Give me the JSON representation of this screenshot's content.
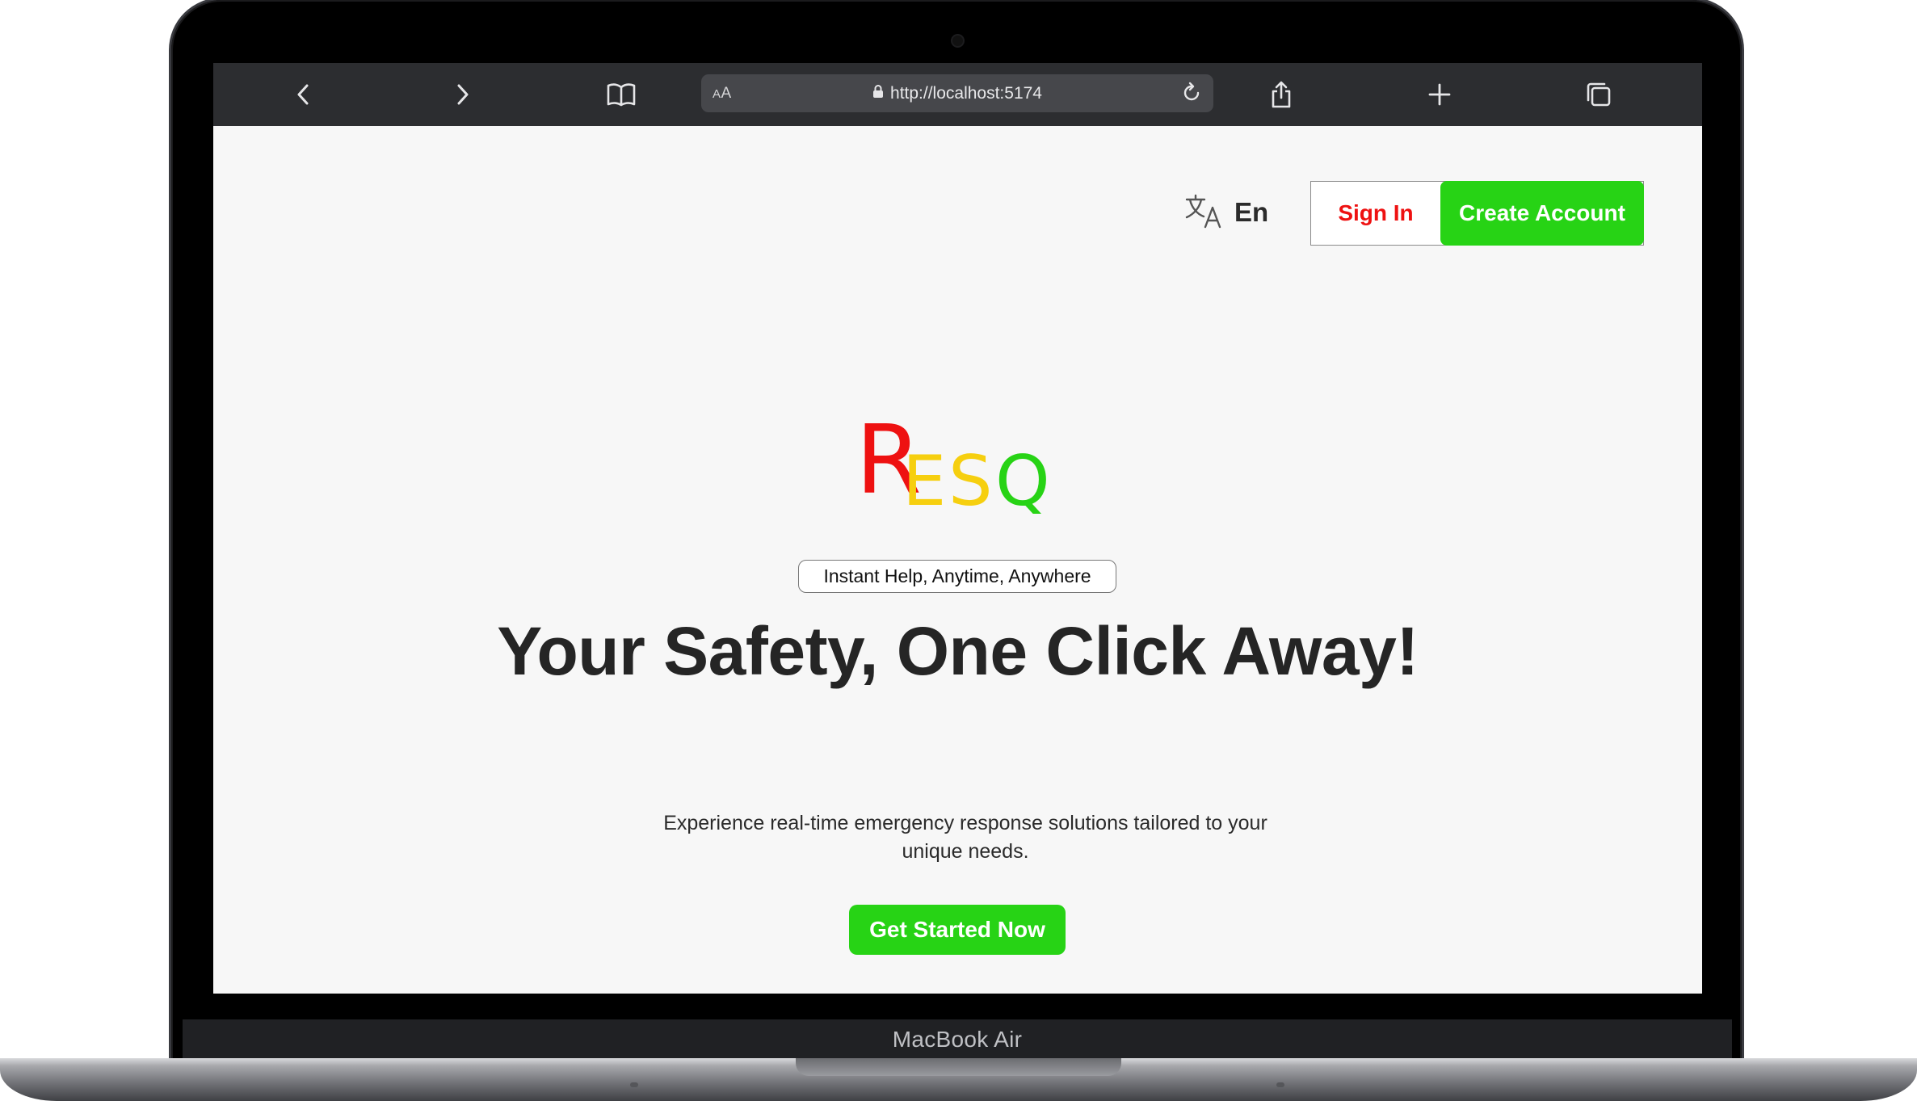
{
  "device": {
    "label": "MacBook Air"
  },
  "browser": {
    "url": "http://localhost:5174",
    "reader_label": "AA",
    "icons": [
      "back-icon",
      "forward-icon",
      "bookmarks-icon",
      "lock-icon",
      "reload-icon",
      "share-icon",
      "new-tab-icon",
      "tabs-icon"
    ]
  },
  "header": {
    "language_code": "En",
    "sign_in_label": "Sign In",
    "create_account_label": "Create Account"
  },
  "logo": {
    "letters": [
      {
        "char": "R",
        "color": "#ee1111"
      },
      {
        "char": "E",
        "color": "#f6cf0f"
      },
      {
        "char": "S",
        "color": "#f6cf0f"
      },
      {
        "char": "Q",
        "color": "#27d315"
      }
    ]
  },
  "hero": {
    "tagline": "Instant Help, Anytime, Anywhere",
    "headline": "Your Safety, One Click Away!",
    "subtext": "Experience real-time emergency response solutions tailored to your unique needs.",
    "cta_label": "Get Started Now"
  },
  "colors": {
    "accent_green": "#27d315",
    "sign_in_red": "#ee1111",
    "logo_yellow": "#f6cf0f"
  }
}
